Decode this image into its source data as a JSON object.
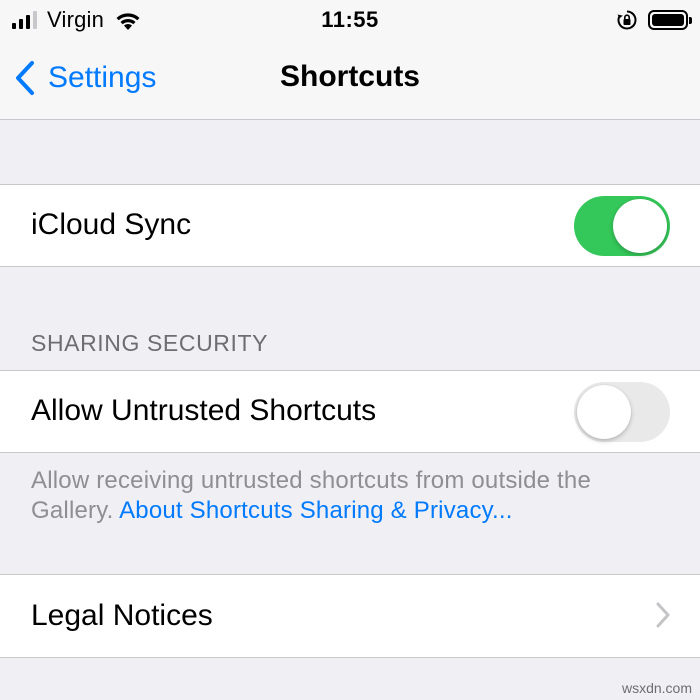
{
  "status_bar": {
    "carrier": "Virgin",
    "time": "11:55",
    "signal_bars": 4,
    "signal_active_bars": 3,
    "icons": [
      "signal-icon",
      "wifi-icon",
      "orientation-lock-icon",
      "battery-icon"
    ],
    "battery_level": 1.0
  },
  "nav": {
    "back_label": "Settings",
    "title": "Shortcuts"
  },
  "icloud_sync": {
    "label": "iCloud Sync",
    "enabled": true
  },
  "sharing_security": {
    "header": "SHARING SECURITY",
    "allow_untrusted": {
      "label": "Allow Untrusted Shortcuts",
      "enabled": false
    },
    "footer_text": "Allow receiving untrusted shortcuts from outside the Gallery. ",
    "footer_link": "About Shortcuts Sharing & Privacy..."
  },
  "legal": {
    "label": "Legal Notices"
  },
  "watermark": "wsxdn.com",
  "colors": {
    "accent": "#007aff",
    "toggle_on": "#34c759",
    "toggle_off": "#e9e9ea",
    "background": "#efeff4",
    "secondary_text": "#8e8e93"
  }
}
